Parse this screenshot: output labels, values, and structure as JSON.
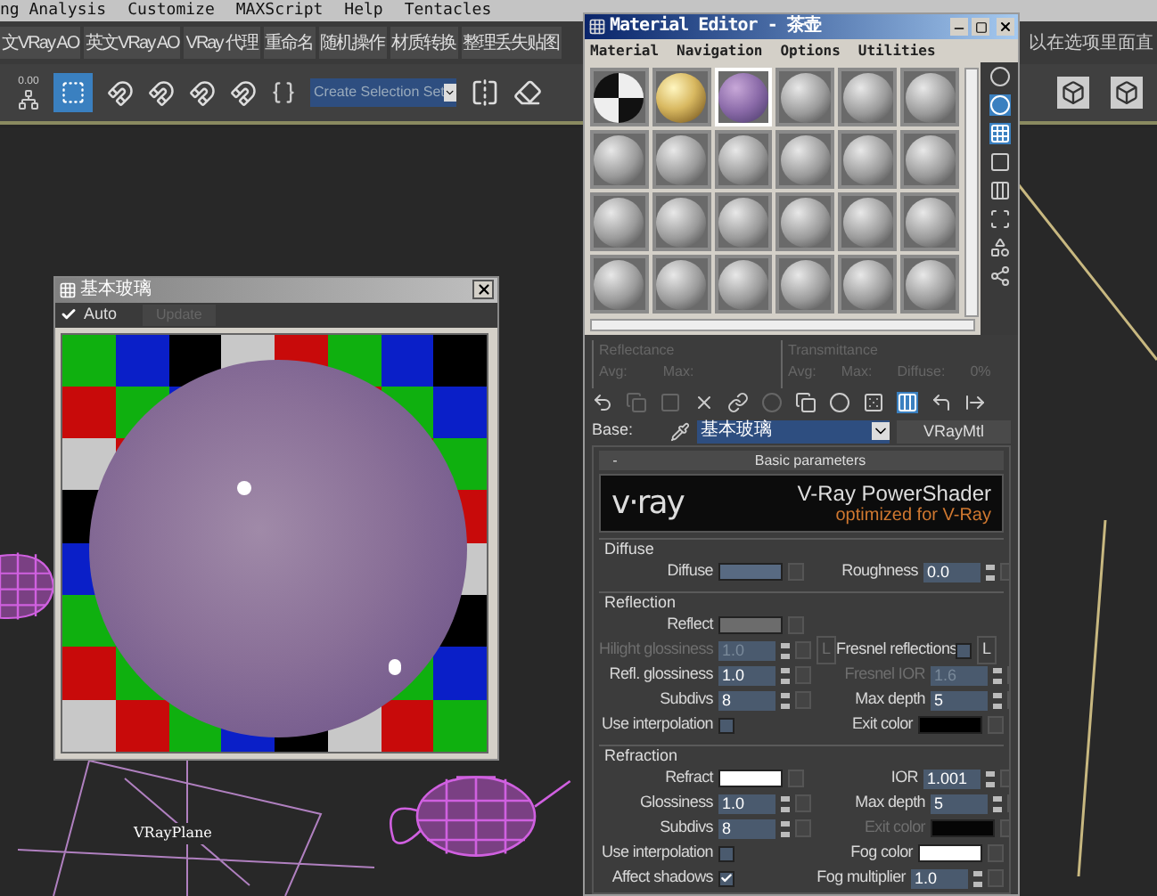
{
  "menu_bar": [
    "ng Analysis",
    "Customize",
    "MAXScript",
    "Help",
    "Tentacles"
  ],
  "script_toolbar": {
    "buttons": [
      "文VRay AO",
      "英文VRay AO",
      "VRay 代理",
      "重命名",
      "随机操作",
      "材质转换",
      "整理丢失贴图"
    ],
    "hint": "以在选项里面直"
  },
  "main_toolbar": {
    "spinner_value": "0.00",
    "selection_set": "Create Selection Set"
  },
  "viewport": {
    "label": "VRayPlane"
  },
  "preview_window": {
    "title": "基本玻璃",
    "auto": {
      "label": "Auto",
      "checked": true
    },
    "update": {
      "label": "Update",
      "disabled": true
    }
  },
  "material_editor": {
    "title": "Material Editor - 茶壶",
    "menu": [
      "Material",
      "Navigation",
      "Options",
      "Utilities"
    ],
    "slots": [
      {
        "kind": "checker",
        "selected": false
      },
      {
        "kind": "gold",
        "selected": false
      },
      {
        "kind": "glass",
        "selected": true
      },
      {
        "kind": "blank",
        "selected": false
      },
      {
        "kind": "blank",
        "selected": false
      },
      {
        "kind": "blank",
        "selected": false
      },
      {
        "kind": "blank",
        "selected": false
      },
      {
        "kind": "blank",
        "selected": false
      },
      {
        "kind": "blank",
        "selected": false
      },
      {
        "kind": "blank",
        "selected": false
      },
      {
        "kind": "blank",
        "selected": false
      },
      {
        "kind": "blank",
        "selected": false
      },
      {
        "kind": "blank",
        "selected": false
      },
      {
        "kind": "blank",
        "selected": false
      },
      {
        "kind": "blank",
        "selected": false
      },
      {
        "kind": "blank",
        "selected": false
      },
      {
        "kind": "blank",
        "selected": false
      },
      {
        "kind": "blank",
        "selected": false
      },
      {
        "kind": "blank",
        "selected": false
      },
      {
        "kind": "blank",
        "selected": false
      },
      {
        "kind": "blank",
        "selected": false
      },
      {
        "kind": "blank",
        "selected": false
      },
      {
        "kind": "blank",
        "selected": false
      },
      {
        "kind": "blank",
        "selected": false
      }
    ],
    "reflectance": {
      "title": "Reflectance",
      "labels": [
        "Avg:",
        "Max:"
      ]
    },
    "transmittance": {
      "title": "Transmittance",
      "labels": [
        "Avg:",
        "Max:",
        "Diffuse:",
        "0%"
      ]
    },
    "base": {
      "label": "Base:",
      "material": "基本玻璃",
      "type": "VRayMtl"
    },
    "rollout": {
      "sign": "-",
      "title": "Basic parameters",
      "expanded": true
    },
    "banner": {
      "logo": "v·ray",
      "title": "V-Ray PowerShader",
      "subtitle": "optimized for V-Ray"
    },
    "groups": [
      {
        "title": "Diffuse",
        "rows": [
          {
            "left": {
              "label": "Diffuse",
              "kind": "color",
              "color": "#586a82",
              "disabled": false
            },
            "right": {
              "label": "Roughness",
              "kind": "spinner",
              "value": "0.0",
              "disabled": false
            }
          }
        ]
      },
      {
        "title": "Reflection",
        "rows": [
          {
            "left": {
              "label": "Reflect",
              "kind": "color",
              "color": "#6c6c6c",
              "disabled": false
            }
          },
          {
            "left": {
              "label": "Hilight glossiness",
              "kind": "spinner",
              "value": "1.0",
              "disabled": true,
              "lock": "L"
            },
            "right": {
              "label": "Fresnel reflections",
              "kind": "checkbox",
              "checked": false,
              "disabled": false,
              "lock": "L"
            }
          },
          {
            "left": {
              "label": "Refl. glossiness",
              "kind": "spinner",
              "value": "1.0",
              "disabled": false
            },
            "right": {
              "label": "Fresnel IOR",
              "kind": "spinner",
              "value": "1.6",
              "disabled": true
            }
          },
          {
            "left": {
              "label": "Subdivs",
              "kind": "spinner",
              "value": "8",
              "disabled": false
            },
            "right": {
              "label": "Max depth",
              "kind": "spinner",
              "value": "5",
              "disabled": false
            }
          },
          {
            "left": {
              "label": "Use interpolation",
              "kind": "checkbox",
              "checked": false,
              "disabled": false
            },
            "right": {
              "label": "Exit color",
              "kind": "color",
              "color": "#000000",
              "disabled": false
            }
          }
        ]
      },
      {
        "title": "Refraction",
        "rows": [
          {
            "left": {
              "label": "Refract",
              "kind": "color",
              "color": "#ffffff",
              "disabled": false
            },
            "right": {
              "label": "IOR",
              "kind": "spinner",
              "value": "1.001",
              "disabled": false
            }
          },
          {
            "left": {
              "label": "Glossiness",
              "kind": "spinner",
              "value": "1.0",
              "disabled": false
            },
            "right": {
              "label": "Max depth",
              "kind": "spinner",
              "value": "5",
              "disabled": false
            }
          },
          {
            "left": {
              "label": "Subdivs",
              "kind": "spinner",
              "value": "8",
              "disabled": false
            },
            "right": {
              "label": "Exit color",
              "kind": "color",
              "color": "#000000",
              "disabled": true
            }
          },
          {
            "left": {
              "label": "Use interpolation",
              "kind": "checkbox",
              "checked": false,
              "disabled": false
            },
            "right": {
              "label": "Fog color",
              "kind": "color",
              "color": "#ffffff",
              "disabled": false
            }
          },
          {
            "left": {
              "label": "Affect shadows",
              "kind": "checkbox",
              "checked": true,
              "disabled": false
            },
            "right": {
              "label": "Fog multiplier",
              "kind": "spinner",
              "value": "1.0",
              "disabled": false
            }
          }
        ]
      }
    ]
  }
}
